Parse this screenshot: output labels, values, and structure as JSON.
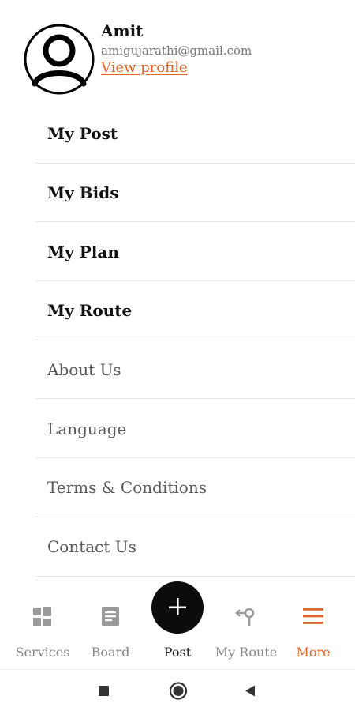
{
  "profile": {
    "name": "Amit",
    "email": "amigujarathi@gmail.com",
    "view_profile_label": "View profile"
  },
  "menu": {
    "items": [
      {
        "label": "My Post",
        "style": "bold"
      },
      {
        "label": "My Bids",
        "style": "bold"
      },
      {
        "label": "My Plan",
        "style": "bold"
      },
      {
        "label": "My Route",
        "style": "bold"
      },
      {
        "label": "About Us",
        "style": "light"
      },
      {
        "label": "Language",
        "style": "light"
      },
      {
        "label": "Terms & Conditions",
        "style": "light"
      },
      {
        "label": "Contact Us",
        "style": "light"
      }
    ]
  },
  "bottom_nav": {
    "items": [
      {
        "label": "Services",
        "icon": "grid-icon"
      },
      {
        "label": "Board",
        "icon": "board-icon"
      },
      {
        "label": "Post",
        "icon": "plus-icon"
      },
      {
        "label": "My Route",
        "icon": "route-icon"
      },
      {
        "label": "More",
        "icon": "menu-icon",
        "active": true
      }
    ]
  },
  "system_nav": {
    "icons": [
      "recents-square-icon",
      "home-circle-icon",
      "back-triangle-icon"
    ]
  },
  "colors": {
    "accent": "#e0662a",
    "inactive": "#888888",
    "fab": "#0c0c0c"
  }
}
